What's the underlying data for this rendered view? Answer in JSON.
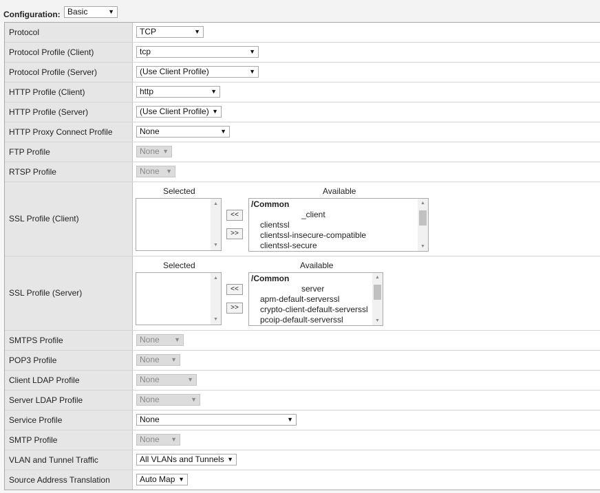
{
  "config": {
    "label": "Configuration:",
    "mode": "Basic"
  },
  "rows": {
    "protocol": {
      "label": "Protocol",
      "value": "TCP"
    },
    "proto_client": {
      "label": "Protocol Profile (Client)",
      "value": "tcp"
    },
    "proto_server": {
      "label": "Protocol Profile (Server)",
      "value": "(Use Client Profile)"
    },
    "http_client": {
      "label": "HTTP Profile (Client)",
      "value": "http"
    },
    "http_server": {
      "label": "HTTP Profile (Server)",
      "value": "(Use Client Profile)"
    },
    "http_proxy": {
      "label": "HTTP Proxy Connect Profile",
      "value": "None"
    },
    "ftp": {
      "label": "FTP Profile",
      "value": "None"
    },
    "rtsp": {
      "label": "RTSP Profile",
      "value": "None"
    },
    "ssl_client": {
      "label": "SSL Profile (Client)",
      "selected_title": "Selected",
      "available_title": "Available",
      "group": "/Common",
      "items": [
        "_client",
        "clientssl",
        "clientssl-insecure-compatible",
        "clientssl-secure"
      ],
      "add_label": "<<",
      "remove_label": ">>"
    },
    "ssl_server": {
      "label": "SSL Profile (Server)",
      "selected_title": "Selected",
      "available_title": "Available",
      "group": "/Common",
      "items": [
        "server",
        "apm-default-serverssl",
        "crypto-client-default-serverssl",
        "pcoip-default-serverssl"
      ],
      "add_label": "<<",
      "remove_label": ">>"
    },
    "smtps": {
      "label": "SMTPS Profile",
      "value": "None"
    },
    "pop3": {
      "label": "POP3 Profile",
      "value": "None"
    },
    "client_ldap": {
      "label": "Client LDAP Profile",
      "value": "None"
    },
    "server_ldap": {
      "label": "Server LDAP Profile",
      "value": "None"
    },
    "service": {
      "label": "Service Profile",
      "value": "None"
    },
    "smtp": {
      "label": "SMTP Profile",
      "value": "None"
    },
    "vlan": {
      "label": "VLAN and Tunnel Traffic",
      "value": "All VLANs and Tunnels"
    },
    "snat": {
      "label": "Source Address Translation",
      "value": "Auto Map"
    }
  }
}
